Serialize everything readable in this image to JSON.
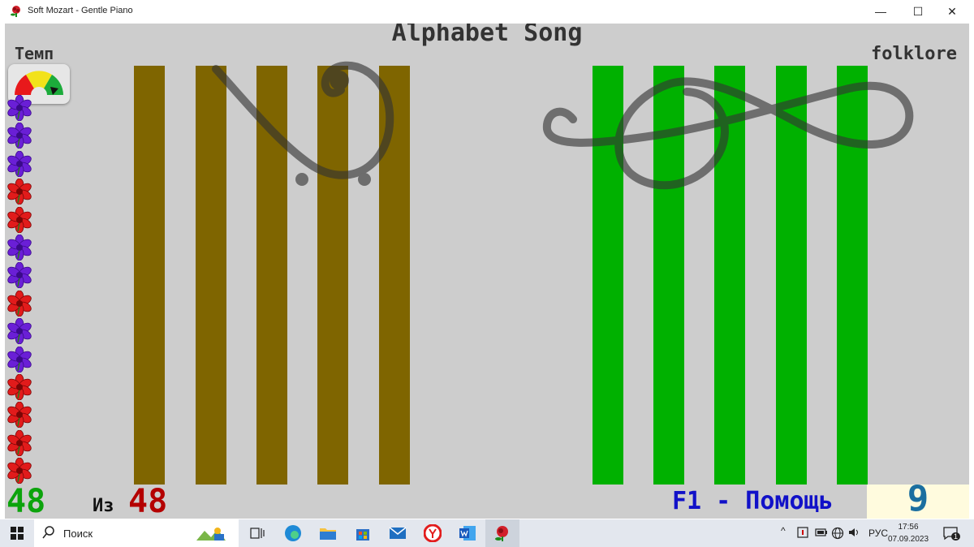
{
  "window": {
    "title": "Soft Mozart - Gentle Piano",
    "minimize": "—",
    "maximize": "☐",
    "close": "✕"
  },
  "song": {
    "title": "Alphabet Song",
    "category": "folklore"
  },
  "tempo": {
    "label": "Темп"
  },
  "flowers": [
    "purple",
    "purple",
    "purple",
    "red",
    "red",
    "purple",
    "purple",
    "red",
    "purple",
    "purple",
    "red",
    "red",
    "red",
    "red"
  ],
  "bars": {
    "left_color": "#7f6500",
    "right_color": "#00b100"
  },
  "status": {
    "played": "48",
    "of_label": "Из",
    "total": "48",
    "help_hint": "F1 - Помощь",
    "score": "9"
  },
  "taskbar": {
    "search_placeholder": "Поиск",
    "language": "РУС",
    "time": "17:56",
    "date": "07.09.2023",
    "notifications_count": "1"
  }
}
